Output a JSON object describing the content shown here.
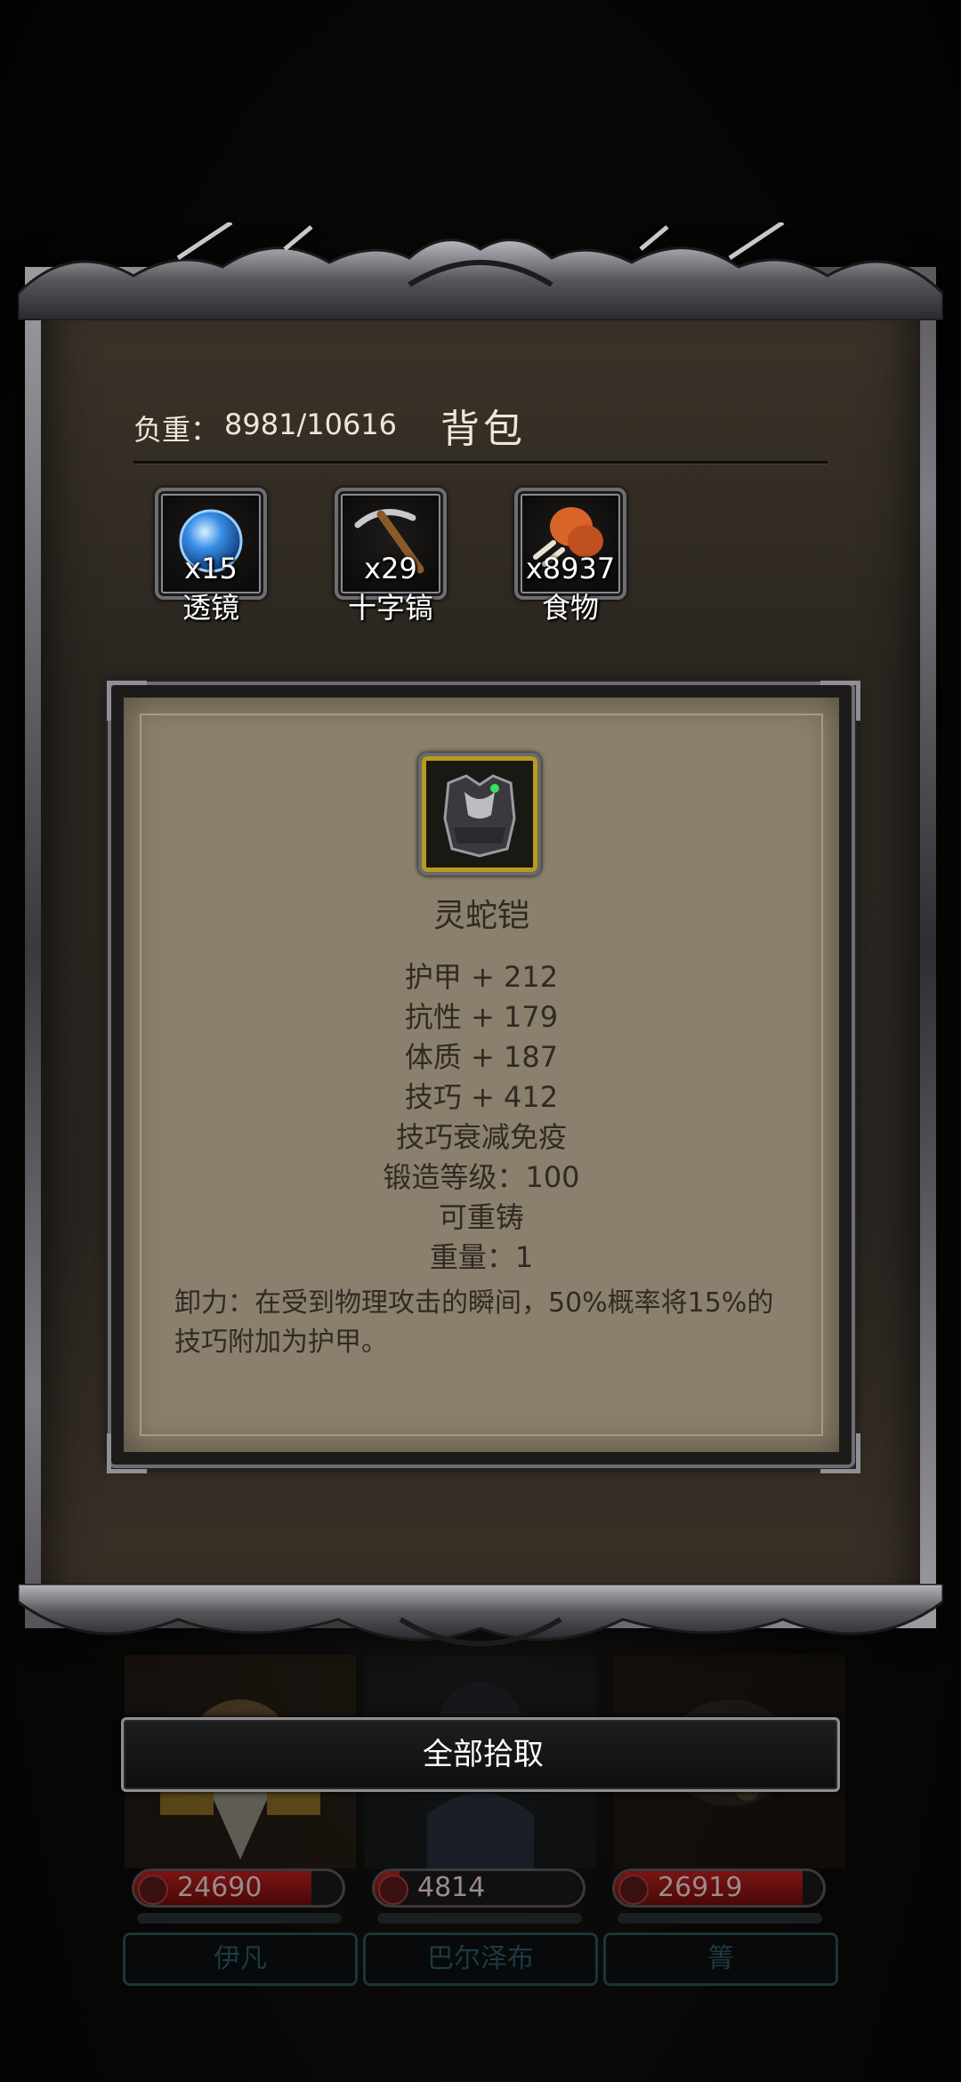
{
  "inventory": {
    "weight_label": "负重：",
    "weight_value": "8981/10616",
    "title": "背包"
  },
  "consumables": [
    {
      "name": "透镜",
      "count": "x15",
      "icon": "lens-orb-icon"
    },
    {
      "name": "十字镐",
      "count": "x29",
      "icon": "pickaxe-icon"
    },
    {
      "name": "食物",
      "count": "x8937",
      "icon": "meat-drumstick-icon"
    }
  ],
  "item": {
    "icon": "armor-chestplate-icon",
    "name": "灵蛇铠",
    "stats": [
      "护甲 + 212",
      "抗性 + 179",
      "体质 + 187",
      "技巧 + 412",
      "技巧衰减免疫",
      "锻造等级：100",
      "可重铸",
      "重量：1"
    ],
    "description": "卸力：在受到物理攻击的瞬间，50%概率将15%的技巧附加为护甲。"
  },
  "actions": {
    "pickup_all": "全部拾取"
  },
  "heroes": [
    {
      "name": "伊凡",
      "hp": "24690",
      "hp_fraction": 0.85
    },
    {
      "name": "巴尔泽布",
      "hp": "4814",
      "hp_fraction": 0.12
    },
    {
      "name": "箐",
      "hp": "26919",
      "hp_fraction": 0.9
    }
  ],
  "colors": {
    "parchment": "#8a806d",
    "text_dark": "#2f2a22",
    "gold_frame": "#b89a20",
    "hp_red": "#7a1414"
  }
}
